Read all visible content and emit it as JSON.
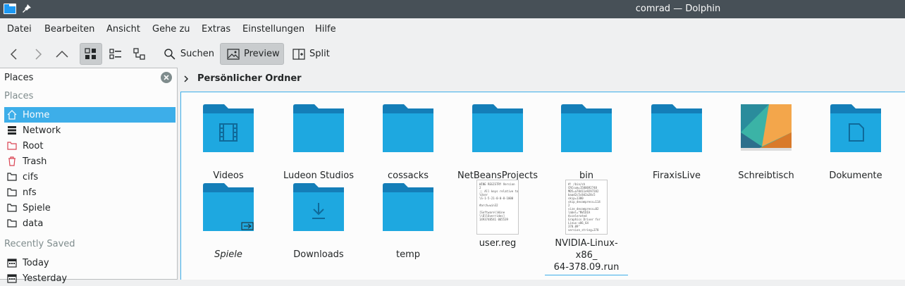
{
  "window": {
    "title": "comrad — Dolphin"
  },
  "menu": [
    "Datei",
    "Bearbeiten",
    "Ansicht",
    "Gehe zu",
    "Extras",
    "Einstellungen",
    "Hilfe"
  ],
  "toolbar": {
    "search_label": "Suchen",
    "preview_label": "Preview",
    "split_label": "Split"
  },
  "places": {
    "header": "Places",
    "section_places": "Places",
    "items": [
      {
        "label": "Home",
        "icon": "home-icon",
        "selected": true
      },
      {
        "label": "Network",
        "icon": "network-icon"
      },
      {
        "label": "Root",
        "icon": "root-folder-icon"
      },
      {
        "label": "Trash",
        "icon": "trash-icon"
      },
      {
        "label": "cifs",
        "icon": "folder-icon"
      },
      {
        "label": "nfs",
        "icon": "folder-icon"
      },
      {
        "label": "Spiele",
        "icon": "folder-icon"
      },
      {
        "label": "data",
        "icon": "folder-icon"
      }
    ],
    "section_recent": "Recently Saved",
    "recent": [
      {
        "label": "Today",
        "icon": "calendar-icon"
      },
      {
        "label": "Yesterday",
        "icon": "calendar-icon"
      }
    ]
  },
  "breadcrumb": {
    "current": "Persönlicher Ordner"
  },
  "files": [
    {
      "name": "Videos",
      "kind": "folder-videos"
    },
    {
      "name": "Ludeon Studios",
      "kind": "folder"
    },
    {
      "name": "cossacks",
      "kind": "folder"
    },
    {
      "name": "NetBeansProjects",
      "kind": "folder"
    },
    {
      "name": "bin",
      "kind": "folder"
    },
    {
      "name": "FiraxisLive",
      "kind": "folder"
    },
    {
      "name": "Schreibtisch",
      "kind": "desktop"
    },
    {
      "name": "Dokumente",
      "kind": "folder-documents"
    },
    {
      "name": "Spiele",
      "kind": "folder-link"
    },
    {
      "name": "Downloads",
      "kind": "folder-downloads"
    },
    {
      "name": "temp",
      "kind": "folder"
    },
    {
      "name": "user.reg",
      "kind": "doc-reg",
      "preview": "WINE REGISTRY Version\n2\n;; All keys relative to \\\n\\User\n\\S-1-5-21-0-0-0-1000\n\n#arch=win32\n\n[Software\\\\Wine\n\\\\DllOverrides]\n1493748541 065539"
    },
    {
      "name": "NVIDIA-Linux-x86_\n64-378.09.run",
      "kind": "doc-run",
      "current": true,
      "preview": "#! /bin/sh\nCRCsum=1580692748\nMD5=a78411e9297282\nbaad2c5c8d2a28c5\nskip=1380\nskip_decompress=114\n2\nsize_decompress=82\nlabel=\"NVIDIA\nAccelerated\nGraphics Driver for\nLinux-x86_64\n378.09\"\nversion_string=378"
    }
  ],
  "colors": {
    "accent": "#3daee9",
    "folder": "#1d99f3",
    "titlebar": "#475057"
  }
}
